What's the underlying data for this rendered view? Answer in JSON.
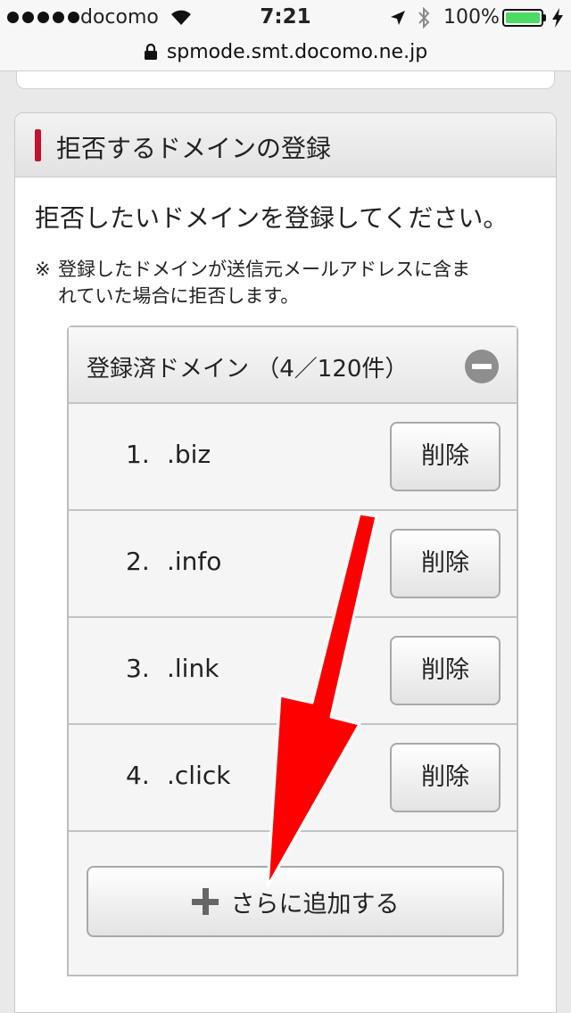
{
  "status_bar": {
    "carrier": "docomo",
    "time": "7:21",
    "battery_percent": "100%",
    "battery_color": "#4cd964"
  },
  "url_bar": {
    "url": "spmode.smt.docomo.ne.jp"
  },
  "section": {
    "title": "拒否するドメインの登録",
    "accent_color": "#c8102e",
    "lead": "拒否したいドメインを登録してください。",
    "note_mark": "※",
    "note_line1": "登録したドメインが送信元メールアドレスに含ま",
    "note_line2": "れていた場合に拒否します。"
  },
  "domains_box": {
    "title": "登録済ドメイン （4／120件）",
    "rows": [
      {
        "number": "1.",
        "domain": ".biz",
        "delete_label": "削除"
      },
      {
        "number": "2.",
        "domain": ".info",
        "delete_label": "削除"
      },
      {
        "number": "3.",
        "domain": ".link",
        "delete_label": "削除"
      },
      {
        "number": "4.",
        "domain": ".click",
        "delete_label": "削除"
      }
    ],
    "add_label": "さらに追加する"
  },
  "annotation": {
    "arrow_color": "#ff0000"
  }
}
